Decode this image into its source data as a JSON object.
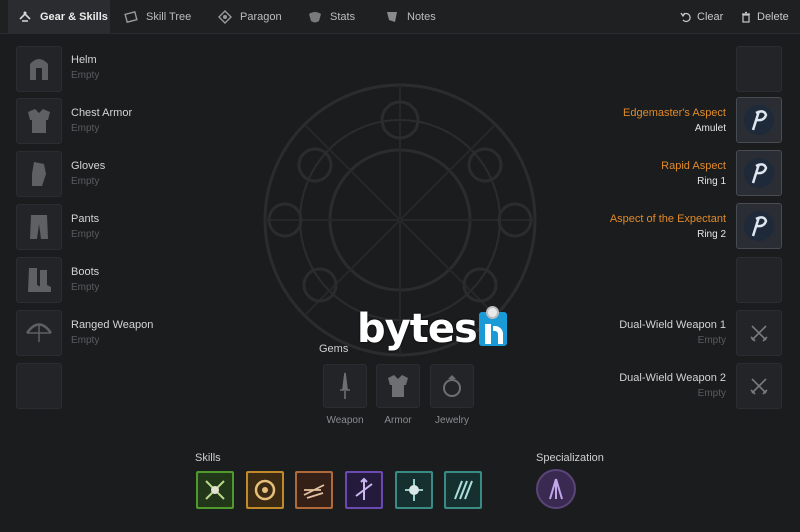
{
  "tabs": [
    {
      "label": "Gear & Skills",
      "icon": "gear-skills-icon",
      "active": true
    },
    {
      "label": "Skill Tree",
      "icon": "skill-tree-icon"
    },
    {
      "label": "Paragon",
      "icon": "paragon-icon"
    },
    {
      "label": "Stats",
      "icon": "stats-icon"
    },
    {
      "label": "Notes",
      "icon": "notes-icon"
    }
  ],
  "actions": {
    "clear": "Clear",
    "delete": "Delete"
  },
  "left_slots": [
    {
      "name": "Helm",
      "status": "Empty",
      "icon": "helm-icon"
    },
    {
      "name": "Chest Armor",
      "status": "Empty",
      "icon": "chest-armor-icon"
    },
    {
      "name": "Gloves",
      "status": "Empty",
      "icon": "gloves-icon"
    },
    {
      "name": "Pants",
      "status": "Empty",
      "icon": "pants-icon"
    },
    {
      "name": "Boots",
      "status": "Empty",
      "icon": "boots-icon"
    },
    {
      "name": "Ranged Weapon",
      "status": "Empty",
      "icon": "bow-icon"
    }
  ],
  "right_slots": [
    {
      "aspect": "Edgemaster's Aspect",
      "slot": "Amulet",
      "icon": "aspect-icon"
    },
    {
      "aspect": "Rapid Aspect",
      "slot": "Ring 1",
      "icon": "aspect-icon"
    },
    {
      "aspect": "Aspect of the Expectant",
      "slot": "Ring 2",
      "icon": "aspect-icon"
    }
  ],
  "weapon_slots": [
    {
      "name": "Dual-Wield Weapon 1",
      "status": "Empty",
      "icon": "crossed-swords-icon"
    },
    {
      "name": "Dual-Wield Weapon 2",
      "status": "Empty",
      "icon": "crossed-swords-icon"
    }
  ],
  "gems": {
    "label": "Gems",
    "items": [
      {
        "label": "Weapon",
        "icon": "dagger-gem-icon"
      },
      {
        "label": "Armor",
        "icon": "armor-gem-icon"
      },
      {
        "label": "Jewelry",
        "icon": "ring-gem-icon"
      }
    ]
  },
  "skills": {
    "label": "Skills",
    "items": [
      {
        "icon": "skill-1-icon",
        "color": "#4f9a2a"
      },
      {
        "icon": "skill-2-icon",
        "color": "#c08a2a"
      },
      {
        "icon": "skill-3-icon",
        "color": "#b06a3a"
      },
      {
        "icon": "skill-4-icon",
        "color": "#6a4ab0"
      },
      {
        "icon": "skill-5-icon",
        "color": "#3a8a86"
      },
      {
        "icon": "skill-6-icon",
        "color": "#3a8a86"
      }
    ]
  },
  "specialization": {
    "label": "Specialization",
    "icon": "specialization-icon"
  },
  "watermark": {
    "text": "bytes",
    "badge": "in"
  },
  "colors": {
    "aspect": "#e08a2a",
    "background": "#1b1c1e"
  }
}
